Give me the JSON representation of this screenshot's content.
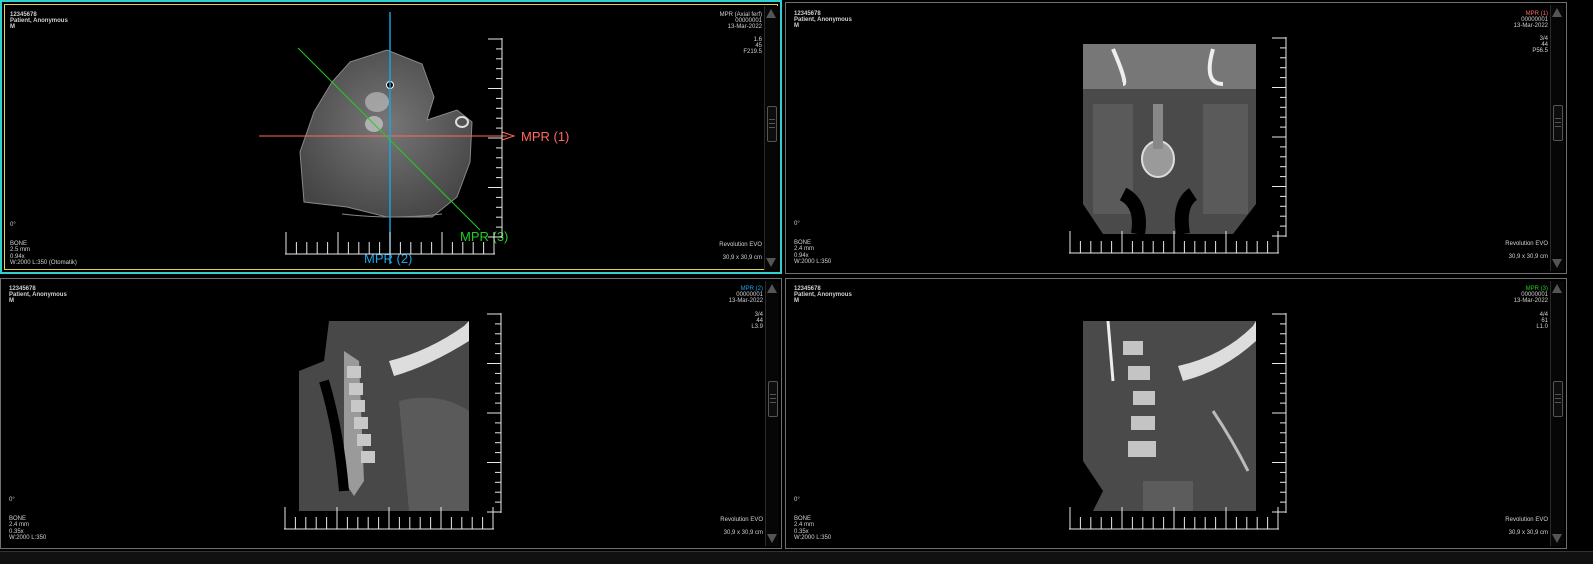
{
  "colors": {
    "active_border": "#2fd0d0",
    "inner_border": "#e6d34a",
    "mpr1": "#ff6a5e",
    "mpr2": "#1aa6e8",
    "mpr3": "#22cc22"
  },
  "viewports": [
    {
      "patient_id": "12345678",
      "patient_name": "Patient, Anonymous",
      "sex": "M",
      "series_title": "MPR (Axial ferf)",
      "study_no": "00000001",
      "date": "13-Mar-2022",
      "info_lines": [
        "1.6",
        "45",
        "F219.5"
      ],
      "orientation": "0°",
      "bottom_left": [
        "BONE",
        "2.5 mm",
        "0.94x",
        "W:2000 L:350 (Otomatik)"
      ],
      "scanner": "Revolution EVO",
      "fov": "30,9 x 30,9 cm",
      "mpr_labels": [
        "MPR (1)",
        "MPR (2)",
        "MPR (3)"
      ]
    },
    {
      "patient_id": "12345678",
      "patient_name": "Patient, Anonymous",
      "sex": "M",
      "series_title": "MPR (1)",
      "study_no": "00000001",
      "date": "13-Mar-2022",
      "info_lines": [
        "3/4",
        "44",
        "P56.5"
      ],
      "orientation": "0°",
      "bottom_left": [
        "BONE",
        "2.4 mm",
        "0.94x",
        "W:2000 L:350"
      ],
      "scanner": "Revolution EVO",
      "fov": "30,9 x 30,9 cm"
    },
    {
      "patient_id": "12345678",
      "patient_name": "Patient, Anonymous",
      "sex": "M",
      "series_title": "MPR (2)",
      "study_no": "00000001",
      "date": "13-Mar-2022",
      "info_lines": [
        "3/4",
        "44",
        "L3.9"
      ],
      "orientation": "0°",
      "bottom_left": [
        "BONE",
        "2.4 mm",
        "0.35x",
        "W:2000 L:350"
      ],
      "scanner": "Revolution EVO",
      "fov": "30,9 x 30,9 cm"
    },
    {
      "patient_id": "12345678",
      "patient_name": "Patient, Anonymous",
      "sex": "M",
      "series_title": "MPR (3)",
      "study_no": "00000001",
      "date": "13-Mar-2022",
      "info_lines": [
        "4/4",
        "61",
        "L1.0"
      ],
      "orientation": "0°",
      "bottom_left": [
        "BONE",
        "2.4 mm",
        "0.35x",
        "W:2000 L:350"
      ],
      "scanner": "Revolution EVO",
      "fov": "30,9 x 30,9 cm"
    }
  ]
}
